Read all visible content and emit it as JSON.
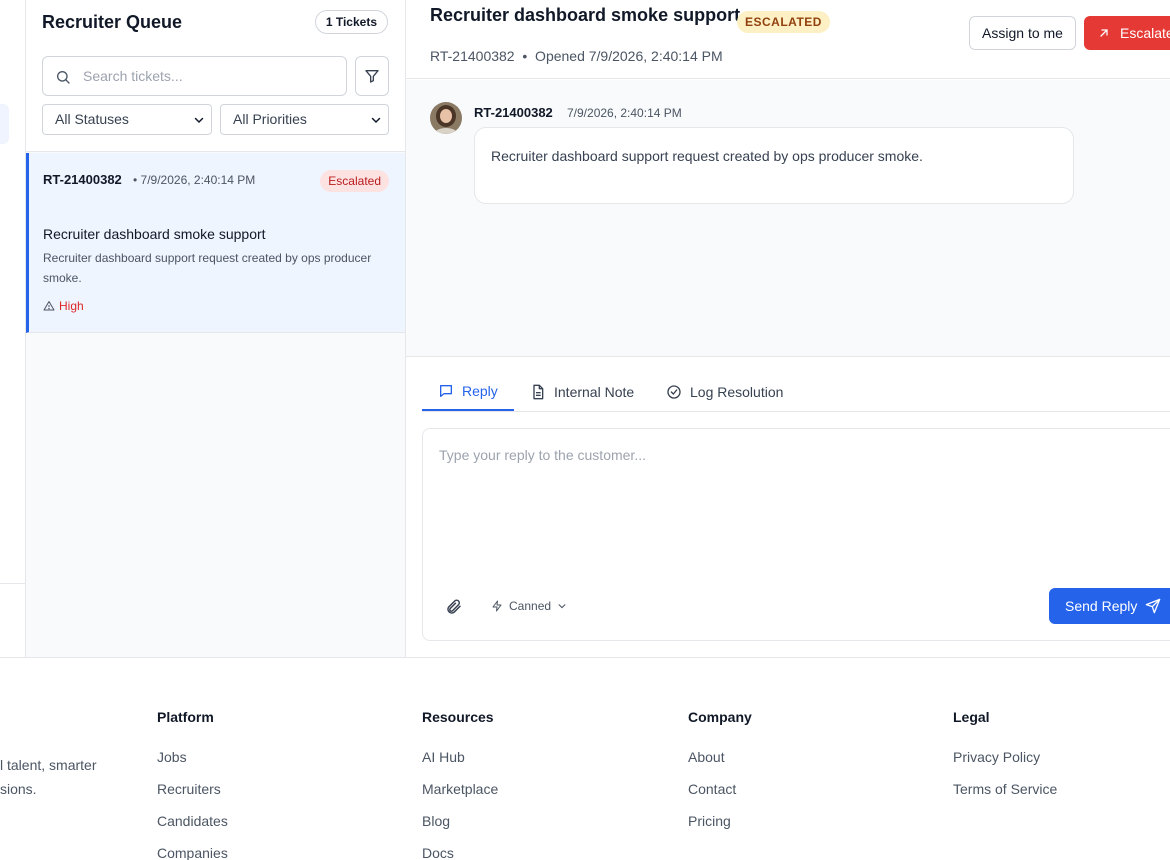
{
  "queue": {
    "title": "Recruiter Queue",
    "count": "1 Tickets",
    "search_placeholder": "Search tickets...",
    "status_filter": "All Statuses",
    "priority_filter": "All Priorities"
  },
  "tickets": [
    {
      "id": "RT-21400382",
      "time": "• 7/9/2026, 2:40:14 PM",
      "status": "Escalated",
      "subject": "Recruiter dashboard smoke support",
      "description": "Recruiter dashboard support request created by ops producer smoke.",
      "priority": "High"
    }
  ],
  "detail": {
    "title": "Recruiter dashboard smoke support",
    "status_badge": "ESCALATED",
    "meta": "RT-21400382  •  Opened 7/9/2026, 2:40:14 PM",
    "assign_label": "Assign to me",
    "escalate_label": "Escalate",
    "message": {
      "author": "RT-21400382",
      "time": "7/9/2026, 2:40:14 PM",
      "body": "Recruiter dashboard support request created by ops producer smoke."
    }
  },
  "reply": {
    "tabs": [
      "Reply",
      "Internal Note",
      "Log Resolution"
    ],
    "active_tab": "Reply",
    "placeholder": "Type your reply to the customer...",
    "canned_label": "Canned",
    "send_label": "Send Reply"
  },
  "footer": {
    "tagline_lines": [
      "l talent, smarter",
      "sions."
    ],
    "columns": [
      {
        "heading": "Platform",
        "links": [
          "Jobs",
          "Recruiters",
          "Candidates",
          "Companies"
        ]
      },
      {
        "heading": "Resources",
        "links": [
          "AI Hub",
          "Marketplace",
          "Blog",
          "Docs"
        ]
      },
      {
        "heading": "Company",
        "links": [
          "About",
          "Contact",
          "Pricing"
        ]
      },
      {
        "heading": "Legal",
        "links": [
          "Privacy Policy",
          "Terms of Service"
        ]
      }
    ]
  },
  "colors": {
    "accent": "#2563eb",
    "danger": "#e53935",
    "escalated_bg": "#fdf0c4",
    "escalated_text": "#92400e"
  }
}
